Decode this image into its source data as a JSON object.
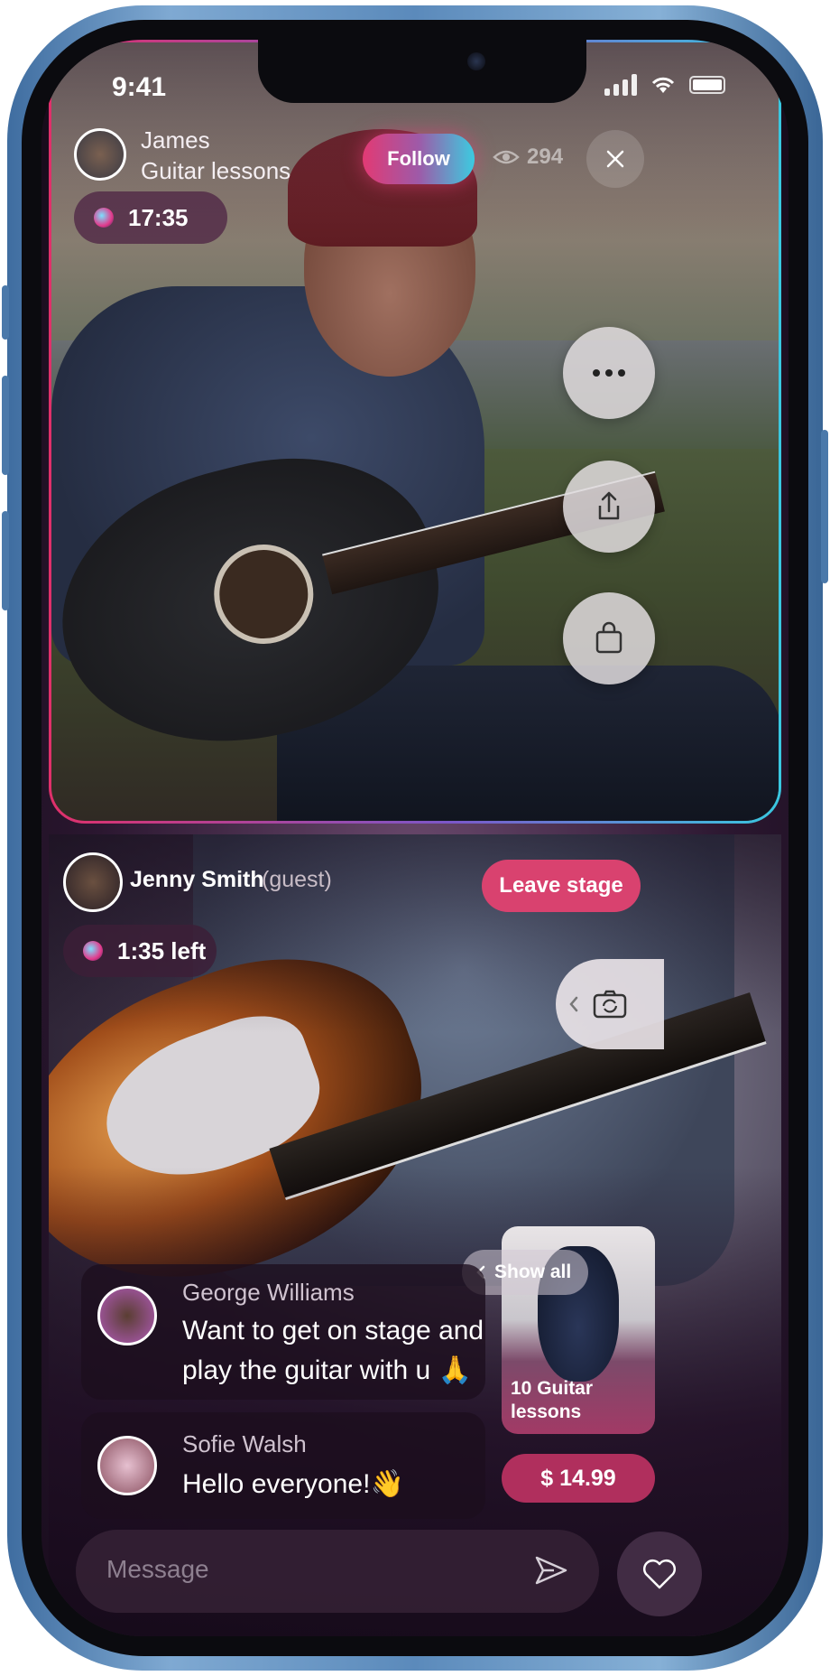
{
  "status_bar": {
    "time": "9:41"
  },
  "host": {
    "name": "James",
    "subtitle": "Guitar lessons",
    "follow_label": "Follow",
    "viewers": "294",
    "timer": "17:35"
  },
  "side_actions": {
    "more_icon": "more-horizontal-icon",
    "share_icon": "share-icon",
    "shop_icon": "shopping-bag-icon"
  },
  "guest": {
    "name": "Jenny Smith",
    "tag": "(guest)",
    "leave_label": "Leave stage",
    "time_left": "1:35 left"
  },
  "camera_switch_icon": "camera-flip-icon",
  "chat": [
    {
      "name": "George Williams",
      "message_line1": "Want to get on stage and",
      "message_line2": "play the guitar with u 🙏"
    },
    {
      "name": "Sofie Walsh",
      "message": "Hello everyone!👋"
    }
  ],
  "product": {
    "show_all_label": "Show all",
    "title_line1": "10 Guitar",
    "title_line2": "lessons",
    "price": "$ 14.99"
  },
  "composer": {
    "placeholder": "Message",
    "send_icon": "send-icon",
    "like_icon": "heart-icon"
  },
  "colors": {
    "accent_pink": "#d63a6e",
    "accent_cyan": "#3fc4de"
  }
}
